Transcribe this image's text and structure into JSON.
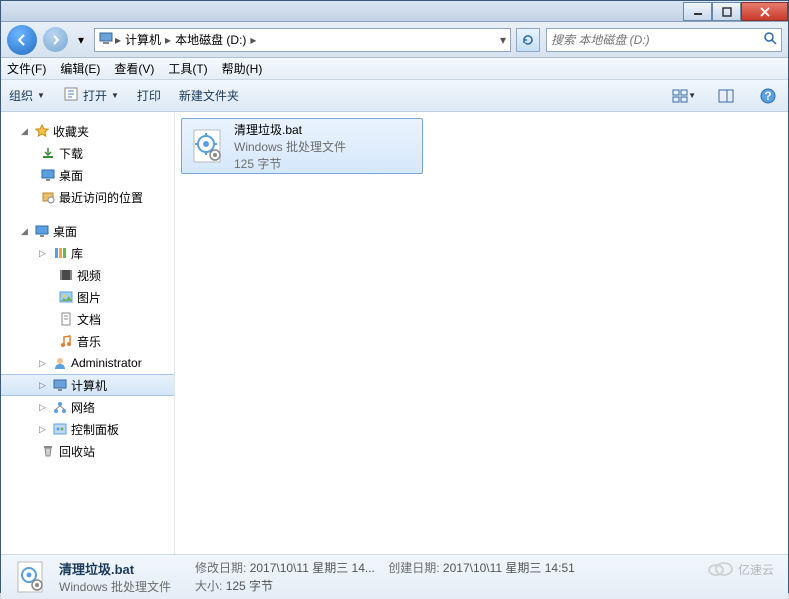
{
  "titlebar": {},
  "address": {
    "crumb1": "计算机",
    "crumb2": "本地磁盘 (D:)",
    "dropdown_hint": "▾"
  },
  "search": {
    "placeholder": "搜索 本地磁盘 (D:)"
  },
  "menu": {
    "file": "文件(F)",
    "edit": "编辑(E)",
    "view": "查看(V)",
    "tools": "工具(T)",
    "help": "帮助(H)"
  },
  "toolbar": {
    "organize": "组织",
    "open": "打开",
    "print": "打印",
    "new_folder": "新建文件夹"
  },
  "sidebar": {
    "favorites": "收藏夹",
    "downloads": "下载",
    "desktop": "桌面",
    "recent": "最近访问的位置",
    "desktop2": "桌面",
    "library": "库",
    "videos": "视频",
    "pictures": "图片",
    "documents": "文档",
    "music": "音乐",
    "admin": "Administrator",
    "computer": "计算机",
    "network": "网络",
    "control_panel": "控制面板",
    "recycle": "回收站"
  },
  "file": {
    "name": "清理垃圾.bat",
    "type": "Windows 批处理文件",
    "size": "125 字节"
  },
  "details": {
    "name": "清理垃圾.bat",
    "type": "Windows 批处理文件",
    "modified_label": "修改日期:",
    "modified_val": "2017\\10\\11 星期三 14...",
    "created_label": "创建日期:",
    "created_val": "2017\\10\\11 星期三 14:51",
    "size_label": "大小:",
    "size_val": "125 字节"
  },
  "watermark": "亿速云"
}
